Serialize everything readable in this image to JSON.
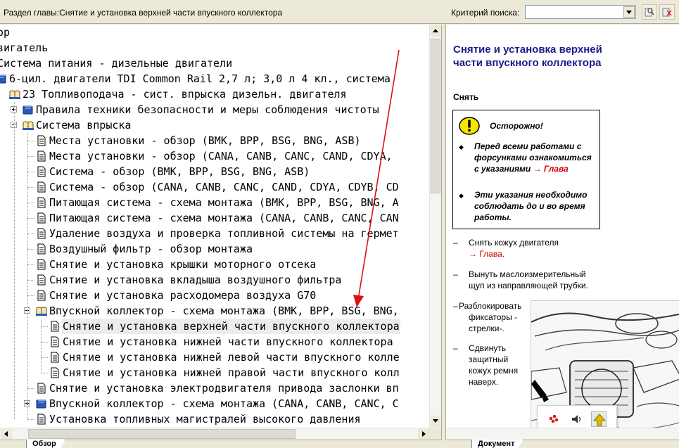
{
  "header": {
    "section_title": "Раздел главы:Снятие и установка верхней части впускного коллектора",
    "search_label": "Критерий поиска:",
    "search_value": "",
    "tool_icons": [
      "search-next-icon",
      "search-clear-icon"
    ]
  },
  "tree": {
    "rows": [
      {
        "label": "ор",
        "indent": 0,
        "expander": "",
        "icon": "",
        "selected": false
      },
      {
        "label": "вигатель",
        "indent": 0,
        "expander": "",
        "icon": "",
        "selected": false
      },
      {
        "label": "Система питания - дизельные двигатели",
        "indent": 0,
        "expander": "",
        "icon": "",
        "selected": false
      },
      {
        "label": "6-цил. двигатели TDI Common Rail 2,7 л; 3,0 л 4 кл., система",
        "indent": 0,
        "expander": "",
        "icon": "book",
        "selected": false
      },
      {
        "label": "23 Топливоподача - сист. впрыска дизельн. двигателя",
        "indent": 1,
        "expander": "",
        "icon": "open-book",
        "selected": false
      },
      {
        "label": "Правила техники безопасности и меры соблюдения чистоты",
        "indent": 2,
        "expander": "plus",
        "icon": "book",
        "selected": false
      },
      {
        "label": "Система впрыска",
        "indent": 2,
        "expander": "minus",
        "icon": "open-book",
        "selected": false
      },
      {
        "label": "Места установки - обзор (BMK, BPP, BSG, BNG, ASB)",
        "indent": 3,
        "expander": "",
        "icon": "page",
        "selected": false
      },
      {
        "label": "Места установки - обзор (CANA, CANB, CANC, CAND, CDYA,",
        "indent": 3,
        "expander": "",
        "icon": "page",
        "selected": false
      },
      {
        "label": "Система - обзор (BMK, BPP, BSG, BNG, ASB)",
        "indent": 3,
        "expander": "",
        "icon": "page",
        "selected": false
      },
      {
        "label": "Система - обзор (CANA, CANB, CANC, CAND, CDYA, CDYB, CD",
        "indent": 3,
        "expander": "",
        "icon": "page",
        "selected": false
      },
      {
        "label": "Питающая система - схема монтажа (BMK, BPP, BSG, BNG, A",
        "indent": 3,
        "expander": "",
        "icon": "page",
        "selected": false
      },
      {
        "label": "Питающая система - схема монтажа (CANA, CANB, CANC, CAN",
        "indent": 3,
        "expander": "",
        "icon": "page",
        "selected": false
      },
      {
        "label": "Удаление воздуха и проверка топливной системы на гермет",
        "indent": 3,
        "expander": "",
        "icon": "page",
        "selected": false
      },
      {
        "label": "Воздушный фильтр - обзор монтажа",
        "indent": 3,
        "expander": "",
        "icon": "page",
        "selected": false
      },
      {
        "label": "Снятие и установка крышки моторного отсека",
        "indent": 3,
        "expander": "",
        "icon": "page",
        "selected": false
      },
      {
        "label": "Снятие и установка вкладыша воздушного фильтра",
        "indent": 3,
        "expander": "",
        "icon": "page",
        "selected": false
      },
      {
        "label": "Снятие и установка расходомера воздуха G70",
        "indent": 3,
        "expander": "",
        "icon": "page",
        "selected": false
      },
      {
        "label": "Впускной коллектор - схема монтажа (BMK, BPP, BSG, BNG,",
        "indent": 3,
        "expander": "minus",
        "icon": "open-book",
        "selected": false
      },
      {
        "label": "Снятие и установка верхней части впускного коллектора",
        "indent": 4,
        "expander": "",
        "icon": "page",
        "selected": true
      },
      {
        "label": "Снятие и установка нижней части впускного коллектора",
        "indent": 4,
        "expander": "",
        "icon": "page",
        "selected": false
      },
      {
        "label": "Снятие и установка нижней левой части впускного колле",
        "indent": 4,
        "expander": "",
        "icon": "page",
        "selected": false
      },
      {
        "label": "Снятие и установка нижней правой части впускного колл",
        "indent": 4,
        "expander": "",
        "icon": "page",
        "selected": false
      },
      {
        "label": "Снятие и установка электродвигателя привода заслонки вп",
        "indent": 3,
        "expander": "",
        "icon": "page",
        "selected": false
      },
      {
        "label": "Впускной коллектор - схема монтажа (CANA, CANB, CANC, C",
        "indent": 3,
        "expander": "plus",
        "icon": "book",
        "selected": false
      },
      {
        "label": "Установка топливных магистралей высокого давления",
        "indent": 3,
        "expander": "",
        "icon": "page",
        "selected": false
      }
    ]
  },
  "tabs": {
    "left_tab": "Обзор",
    "right_tab": "Документ"
  },
  "document": {
    "title": "Снятие и установка верхней части впускного коллектора",
    "remove_heading": "Снять",
    "caution": {
      "title": "Осторожно!",
      "item1_text": "Перед всеми работами с форсунками ознакомиться с указаниями",
      "item1_link": "→ Глава",
      "item2_text": "Эти указания необходимо соблюдать до и во время работы."
    },
    "steps": {
      "step1_text": "Снять кожух двигателя",
      "step1_link": "→ Глава.",
      "step2_line1": "Вынуть маслоизмерительный",
      "step2_line2": "щуп из направляющей трубки.",
      "step3_line1": "Разблокировать",
      "step3_line2": "фиксаторы -",
      "step3_line3": "стрелки-.",
      "step4_line1": "Сдвинуть",
      "step4_line2": "защитный",
      "step4_line3": "кожух ремня",
      "step4_line4": "наверх."
    },
    "dash": "–"
  },
  "colors": {
    "title_blue": "#1a1a8c",
    "link_red": "#d60000",
    "arrow_red": "#e01010",
    "selection": "#ececec"
  }
}
